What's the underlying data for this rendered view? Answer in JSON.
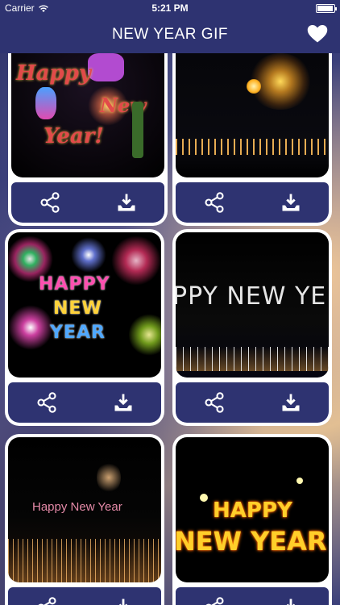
{
  "status": {
    "carrier": "Carrier",
    "time": "5:21 PM"
  },
  "nav": {
    "title": "NEW YEAR GIF"
  },
  "colors": {
    "bar": "#2e3371",
    "card": "#ffffff"
  },
  "cards": [
    {
      "gif_text": "Happy New Year!",
      "line1": "Happy",
      "line2": "New",
      "line3": "Year!"
    },
    {
      "gif_text": ""
    },
    {
      "gif_text": "HAPPY NEW YEAR",
      "line1": "HAPPY",
      "line2": "NEW",
      "line3": "YEAR"
    },
    {
      "gif_text": "PPY NEW YE"
    },
    {
      "gif_text": "Happy New Year"
    },
    {
      "gif_text": "HAPPY NEW YEAR",
      "line1": "HAPPY",
      "line2": "NEW YEAR"
    }
  ],
  "icons": {
    "share": "share-icon",
    "download": "download-icon",
    "favorite": "heart-icon",
    "wifi": "wifi-icon",
    "battery": "battery-icon"
  }
}
